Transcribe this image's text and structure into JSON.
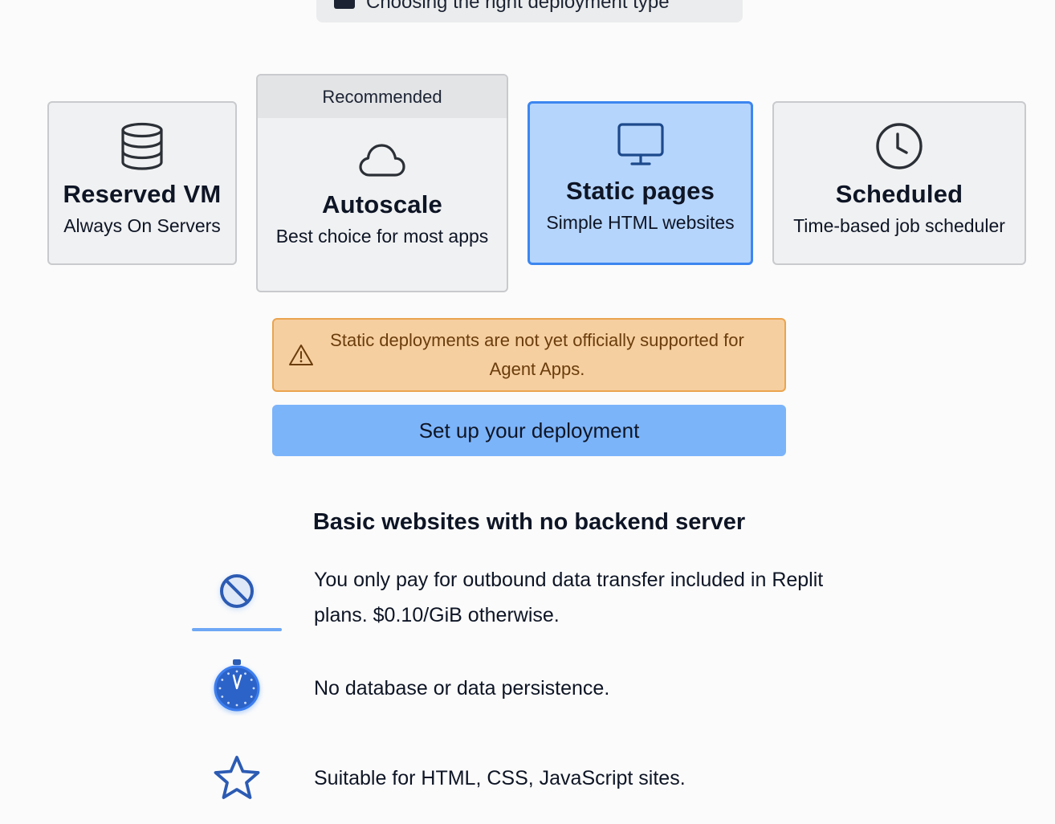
{
  "guide": {
    "label": "Choosing the right deployment type",
    "icon": "book-icon"
  },
  "deployment_types": {
    "reserved_vm": {
      "title": "Reserved VM",
      "subtitle": "Always On Servers",
      "icon": "database-icon"
    },
    "autoscale": {
      "badge": "Recommended",
      "title": "Autoscale",
      "subtitle": "Best choice for most apps",
      "icon": "cloud-icon"
    },
    "static_pages": {
      "title": "Static pages",
      "subtitle": "Simple HTML websites",
      "icon": "monitor-icon",
      "selected": true
    },
    "scheduled": {
      "title": "Scheduled",
      "subtitle": "Time-based job scheduler",
      "icon": "clock-icon"
    }
  },
  "warning": {
    "icon": "warning-triangle-icon",
    "text": "Static deployments are not yet officially supported for Agent Apps."
  },
  "setup_button": {
    "label": "Set up your deployment"
  },
  "details": {
    "heading": "Basic websites with no backend server",
    "features": [
      {
        "icon": "no-entry-icon",
        "text": "You only pay for outbound data transfer included in Replit plans. $0.10/GiB otherwise."
      },
      {
        "icon": "stopwatch-icon",
        "text": "No database or data persistence."
      },
      {
        "icon": "star-icon",
        "text": "Suitable for HTML, CSS, JavaScript sites."
      }
    ]
  },
  "colors": {
    "page_background": "#fbfbfb",
    "card_background": "#f0f1f2",
    "selected_card_background": "#b6d5fc",
    "selected_card_border": "#3c86f0",
    "warning_background": "#f6cfa0",
    "warning_border": "#eaa44f",
    "warning_text": "#6b3d0c",
    "button_background": "#7cb4fa",
    "icon_blue": "#2c5bb3"
  }
}
